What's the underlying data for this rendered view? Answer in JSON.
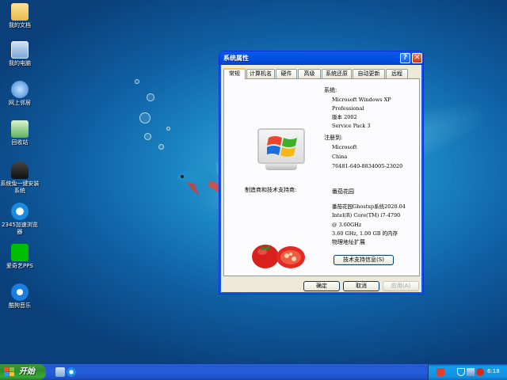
{
  "desktop": {
    "icons": [
      {
        "label": "我的文档",
        "icon": "folder-icon"
      },
      {
        "label": "我的电脑",
        "icon": "computer-icon"
      },
      {
        "label": "网上邻居",
        "icon": "network-icon"
      },
      {
        "label": "回收站",
        "icon": "recycle-bin-icon"
      },
      {
        "label": "系统兔一键安装系统",
        "icon": "rabbit-icon"
      },
      {
        "label": "2345加速浏览器",
        "icon": "browser-icon"
      },
      {
        "label": "爱奇艺PPS",
        "icon": "iqiyi-icon"
      },
      {
        "label": "酷狗音乐",
        "icon": "kugou-icon"
      }
    ]
  },
  "window": {
    "title": "系统属性",
    "help_label": "?",
    "close_label": "✕",
    "tabs": [
      "常规",
      "计算机名",
      "硬件",
      "高级",
      "系统还原",
      "自动更新",
      "远程"
    ],
    "system": {
      "heading": "系统:",
      "lines": [
        "Microsoft Windows XP",
        "Professional",
        "版本 2002",
        "Service Pack 3"
      ]
    },
    "registered": {
      "heading": "注册到:",
      "lines": [
        "Microsoft",
        "China",
        "76481-640-8834005-23020"
      ]
    },
    "manufacturer": {
      "heading": "制造商和技术支持商:",
      "name": "番茄花园",
      "lines": [
        "番茄花园Ghostxp系统2020.04",
        "Intel(R) Core(TM) i7-4790",
        "@ 3.60GHz",
        "3.60 GHz, 1.00 GB 的内存",
        "物理地址扩展"
      ]
    },
    "support_button": "技术支持信息(S)",
    "buttons": {
      "ok": "确定",
      "cancel": "取消",
      "apply": "应用(A)"
    }
  },
  "taskbar": {
    "start_label": "开始",
    "clock": "6:18"
  },
  "colors": {
    "taskbar_blue": "#245ddb",
    "start_green": "#2e8b2e",
    "title_blue": "#0054e3"
  }
}
